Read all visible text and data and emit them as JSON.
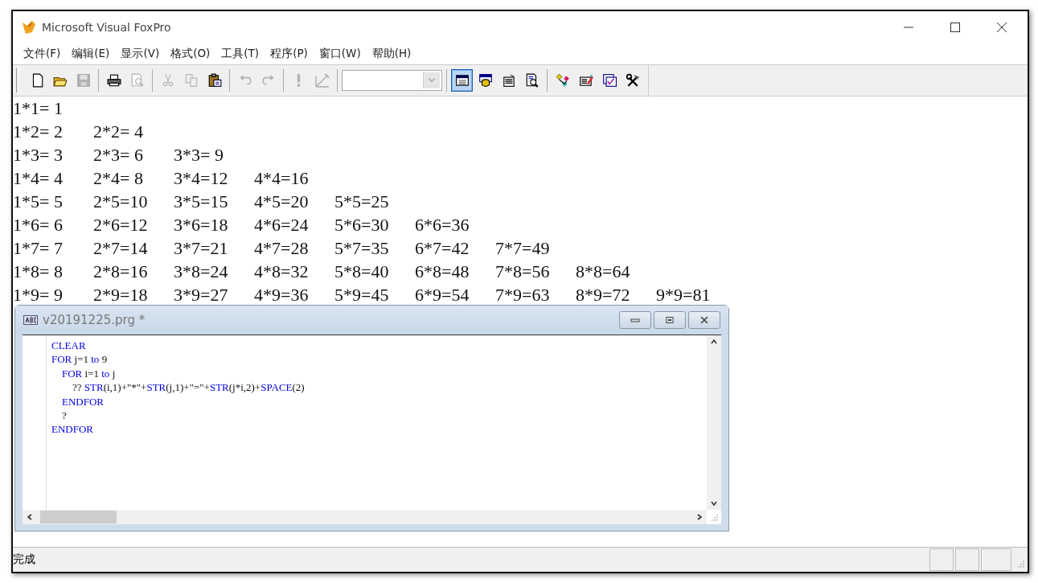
{
  "window": {
    "title": "Microsoft Visual FoxPro"
  },
  "menu": [
    "文件(F)",
    "编辑(E)",
    "显示(V)",
    "格式(O)",
    "工具(T)",
    "程序(P)",
    "窗口(W)",
    "帮助(H)"
  ],
  "toolbar": [
    [
      {
        "kind": "new",
        "disabled": false,
        "selected": false
      },
      {
        "kind": "open",
        "disabled": false,
        "selected": false
      },
      {
        "kind": "save",
        "disabled": true,
        "selected": false
      }
    ],
    [
      {
        "kind": "print",
        "disabled": false,
        "selected": false
      },
      {
        "kind": "preview",
        "disabled": true,
        "selected": false
      }
    ],
    [
      {
        "kind": "cut",
        "disabled": true,
        "selected": false
      },
      {
        "kind": "copy",
        "disabled": true,
        "selected": false
      },
      {
        "kind": "paste",
        "disabled": false,
        "selected": false
      }
    ],
    [
      {
        "kind": "undo",
        "disabled": true,
        "selected": false
      },
      {
        "kind": "redo",
        "disabled": true,
        "selected": false
      }
    ],
    [
      {
        "kind": "run",
        "disabled": true,
        "selected": false
      },
      {
        "kind": "modify",
        "disabled": true,
        "selected": false
      }
    ],
    [
      {
        "kind": "combo",
        "disabled": true
      }
    ],
    [
      {
        "kind": "command",
        "disabled": false,
        "selected": true
      },
      {
        "kind": "database",
        "disabled": false,
        "selected": false
      },
      {
        "kind": "properties",
        "disabled": false,
        "selected": false
      },
      {
        "kind": "report",
        "disabled": false,
        "selected": false
      }
    ],
    [
      {
        "kind": "diagram",
        "disabled": false,
        "selected": false
      },
      {
        "kind": "builder",
        "disabled": false,
        "selected": false
      },
      {
        "kind": "form",
        "disabled": false,
        "selected": false
      },
      {
        "kind": "tools",
        "disabled": false,
        "selected": false
      }
    ]
  ],
  "output": [
    [
      "1*1= 1"
    ],
    [
      "1*2= 2",
      "2*2= 4"
    ],
    [
      "1*3= 3",
      "2*3= 6",
      "3*3= 9"
    ],
    [
      "1*4= 4",
      "2*4= 8",
      "3*4=12",
      "4*4=16"
    ],
    [
      "1*5= 5",
      "2*5=10",
      "3*5=15",
      "4*5=20",
      "5*5=25"
    ],
    [
      "1*6= 6",
      "2*6=12",
      "3*6=18",
      "4*6=24",
      "5*6=30",
      "6*6=36"
    ],
    [
      "1*7= 7",
      "2*7=14",
      "3*7=21",
      "4*7=28",
      "5*7=35",
      "6*7=42",
      "7*7=49"
    ],
    [
      "1*8= 8",
      "2*8=16",
      "3*8=24",
      "4*8=32",
      "5*8=40",
      "6*8=48",
      "7*8=56",
      "8*8=64"
    ],
    [
      "1*9= 9",
      "2*9=18",
      "3*9=27",
      "4*9=36",
      "5*9=45",
      "6*9=54",
      "7*9=63",
      "8*9=72",
      "9*9=81"
    ]
  ],
  "editor": {
    "title": "v20191225.prg *",
    "lines": [
      [
        {
          "text": "CLEAR",
          "kind": "keyword"
        }
      ],
      [
        {
          "text": "FOR",
          "kind": "keyword"
        },
        {
          "text": " j=1 ",
          "kind": "plain"
        },
        {
          "text": "to",
          "kind": "keyword"
        },
        {
          "text": " 9",
          "kind": "plain"
        }
      ],
      [
        {
          "text": "    FOR",
          "kind": "keyword"
        },
        {
          "text": " i=1 ",
          "kind": "plain"
        },
        {
          "text": "to",
          "kind": "keyword"
        },
        {
          "text": " j",
          "kind": "plain"
        }
      ],
      [
        {
          "text": "        ?? ",
          "kind": "plain"
        },
        {
          "text": "STR",
          "kind": "keyword"
        },
        {
          "text": "(i,1)+\"*\"+",
          "kind": "plain"
        },
        {
          "text": "STR",
          "kind": "keyword"
        },
        {
          "text": "(j,1)+\"=\"+",
          "kind": "plain"
        },
        {
          "text": "STR",
          "kind": "keyword"
        },
        {
          "text": "(j*i,2)+",
          "kind": "plain"
        },
        {
          "text": "SPACE",
          "kind": "keyword"
        },
        {
          "text": "(2)",
          "kind": "plain"
        }
      ],
      [
        {
          "text": "    ENDFOR",
          "kind": "keyword"
        }
      ],
      [
        {
          "text": "    ?",
          "kind": "plain"
        }
      ],
      [
        {
          "text": "ENDFOR",
          "kind": "keyword"
        }
      ]
    ]
  },
  "status_bar": {
    "text": "完成"
  }
}
